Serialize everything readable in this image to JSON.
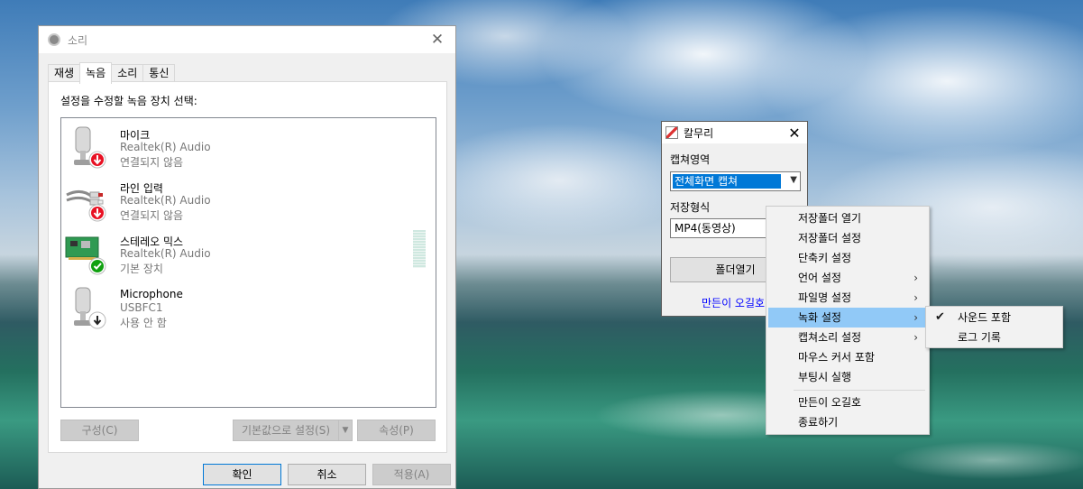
{
  "sound_dialog": {
    "title": "소리",
    "tabs": [
      {
        "label": "재생",
        "active": false
      },
      {
        "label": "녹음",
        "active": true
      },
      {
        "label": "소리",
        "active": false
      },
      {
        "label": "통신",
        "active": false
      }
    ],
    "instruction": "설정을 수정할 녹음 장치 선택:",
    "devices": [
      {
        "name": "마이크",
        "driver": "Realtek(R) Audio",
        "status": "연결되지 않음",
        "icon": "microphone-icon",
        "badge": "disconnected-icon"
      },
      {
        "name": "라인 입력",
        "driver": "Realtek(R) Audio",
        "status": "연결되지 않음",
        "icon": "line-in-cable-icon",
        "badge": "disconnected-icon"
      },
      {
        "name": "스테레오 믹스",
        "driver": "Realtek(R) Audio",
        "status": "기본 장치",
        "icon": "sound-card-icon",
        "badge": "default-check-icon"
      },
      {
        "name": "Microphone",
        "driver": "USBFC1",
        "status": "사용 안 함",
        "icon": "microphone-icon",
        "badge": "disabled-icon"
      }
    ],
    "configure_button": "구성(C)",
    "set_default_button": "기본값으로 설정(S)",
    "properties_button": "속성(P)",
    "ok_button": "확인",
    "cancel_button": "취소",
    "apply_button": "적용(A)"
  },
  "kalmuri": {
    "title": "칼무리",
    "capture_area_label": "캡쳐영역",
    "capture_area_value": "전체화면 캡쳐",
    "save_format_label": "저장형식",
    "save_format_value": "MP4(동영상)",
    "open_folder_button": "폴더열기",
    "credit_link": "만든이 오길호"
  },
  "context_menu": {
    "items": [
      {
        "label": "저장폴더 열기",
        "submenu": false
      },
      {
        "label": "저장폴더 설정",
        "submenu": false
      },
      {
        "label": "단축키 설정",
        "submenu": false
      },
      {
        "label": "언어 설정",
        "submenu": true
      },
      {
        "label": "파일명 설정",
        "submenu": true
      },
      {
        "label": "녹화 설정",
        "submenu": true,
        "highlighted": true
      },
      {
        "label": "캡쳐소리 설정",
        "submenu": true
      },
      {
        "label": "마우스 커서 포함",
        "submenu": false
      },
      {
        "label": "부팅시 실행",
        "submenu": false
      },
      {
        "label": "만든이 오길호",
        "submenu": false
      },
      {
        "label": "종료하기",
        "submenu": false
      }
    ],
    "submenu_recording": [
      {
        "label": "사운드 포함",
        "checked": true
      },
      {
        "label": "로그 기록",
        "checked": false
      }
    ]
  },
  "colors": {
    "menu_highlight": "#91c9f7",
    "selection_blue": "#0078d7",
    "link_blue": "#0000ff",
    "badge_red": "#e81123",
    "badge_green": "#10a010"
  }
}
